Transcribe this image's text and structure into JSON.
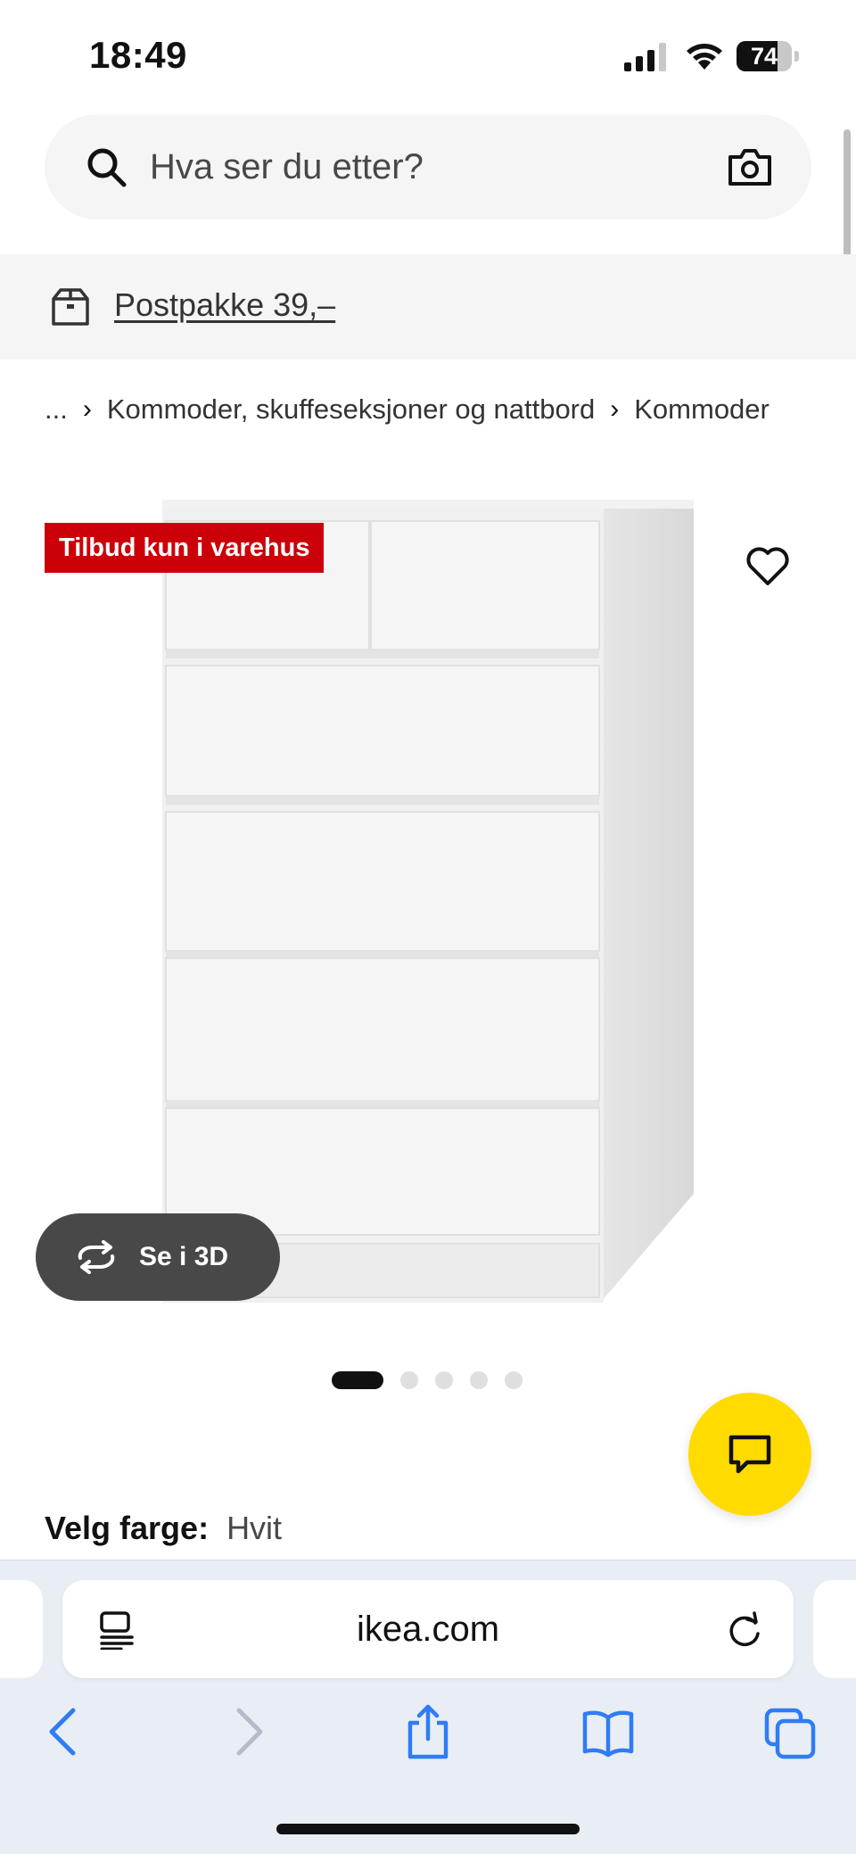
{
  "status_bar": {
    "time": "18:49",
    "battery_level": 74,
    "battery_label": "74"
  },
  "search": {
    "placeholder": "Hva ser du etter?"
  },
  "banner": {
    "link": "Postpakke 39,–"
  },
  "breadcrumb": {
    "ellipsis": "...",
    "items": [
      "Kommoder, skuffeseksjoner og nattbord",
      "Kommoder"
    ]
  },
  "product": {
    "badge": "Tilbud kun i varehus",
    "view3d_label": "Se i 3D",
    "image_count": 5,
    "active_image": 0
  },
  "color_selector": {
    "label": "Velg farge:",
    "value": "Hvit"
  },
  "browser": {
    "url": "ikea.com"
  },
  "colors": {
    "badge_red": "#cc0008",
    "chat_yellow": "#ffdb00",
    "safari_blue": "#2f7cf6",
    "view3d_bg": "#484848"
  },
  "icons": [
    "search-icon",
    "camera-icon",
    "box-icon",
    "heart-icon",
    "rotate-icon",
    "chat-icon",
    "reader-icon",
    "reload-icon",
    "back-icon",
    "forward-icon",
    "share-icon",
    "bookmarks-icon",
    "tabs-icon"
  ]
}
